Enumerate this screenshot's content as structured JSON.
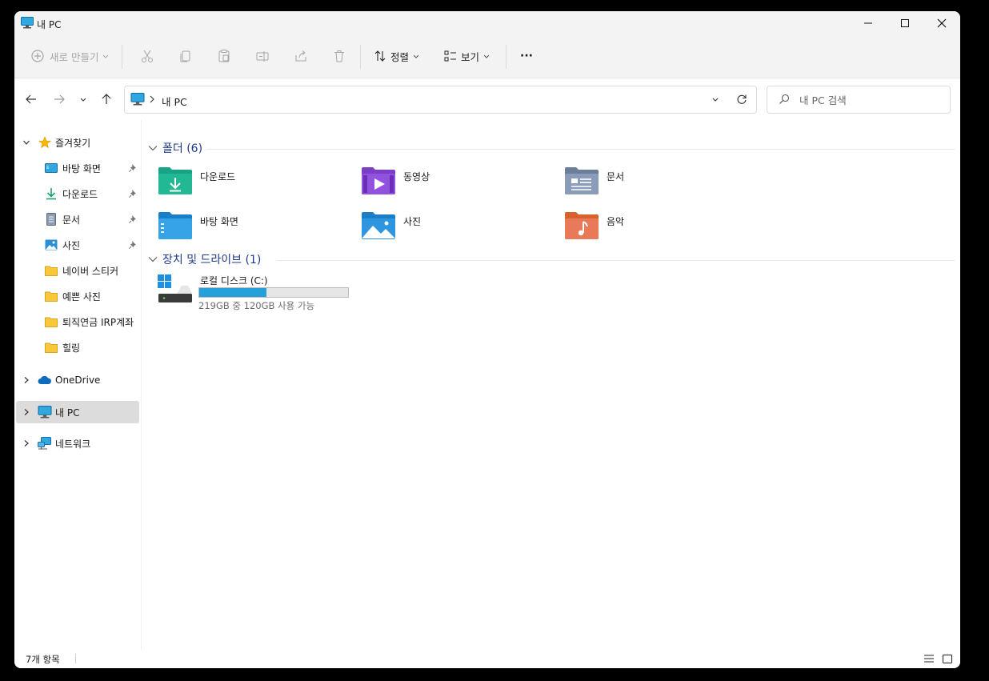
{
  "window": {
    "title": "내 PC"
  },
  "toolbar": {
    "new_label": "새로 만들기",
    "sort_label": "정렬",
    "view_label": "보기",
    "more_label": "···"
  },
  "nav": {
    "address_label": "내 PC",
    "search_placeholder": "내 PC 검색"
  },
  "sidebar": {
    "quick_access": "즐겨찾기",
    "pinned": [
      {
        "label": "바탕 화면",
        "icon": "desktop-folder-icon"
      },
      {
        "label": "다운로드",
        "icon": "download-icon"
      },
      {
        "label": "문서",
        "icon": "document-icon"
      },
      {
        "label": "사진",
        "icon": "pictures-icon"
      }
    ],
    "folders": [
      {
        "label": "네이버 스티커"
      },
      {
        "label": "예쁜 사진"
      },
      {
        "label": "퇴직연금 IRP계좌"
      },
      {
        "label": "힐링"
      }
    ],
    "onedrive": "OneDrive",
    "thispc": "내 PC",
    "network": "네트워크"
  },
  "main": {
    "folders_header": "폴더 (6)",
    "folders": [
      {
        "label": "다운로드",
        "icon": "downloads-folder-icon"
      },
      {
        "label": "동영상",
        "icon": "videos-folder-icon"
      },
      {
        "label": "문서",
        "icon": "documents-folder-icon"
      },
      {
        "label": "바탕 화면",
        "icon": "desktop-folder-icon"
      },
      {
        "label": "사진",
        "icon": "pictures-folder-icon"
      },
      {
        "label": "음악",
        "icon": "music-folder-icon"
      }
    ],
    "drives_header": "장치 및 드라이브 (1)",
    "drive": {
      "label": "로컬 디스크 (C:)",
      "detail": "219GB 중 120GB 사용 가능",
      "used_fraction": 0.45
    }
  },
  "status": {
    "item_count": "7개 항목"
  },
  "colors": {
    "accent": "#0078d4",
    "drive_bar": "#26a0da"
  }
}
